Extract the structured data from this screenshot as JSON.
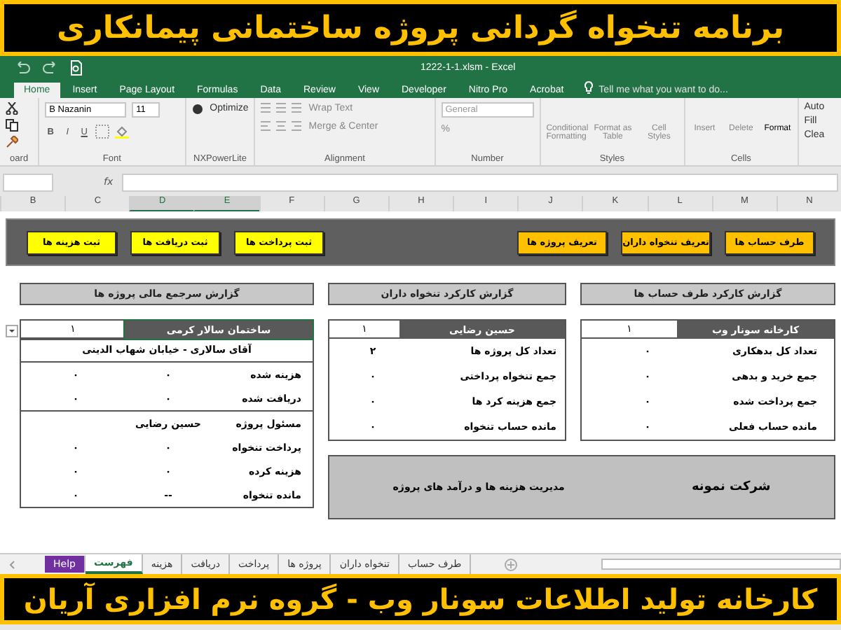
{
  "banner_top": {
    "title": "برنامه تنخواه گردانی پروژه ساختمانی پیمانکاری"
  },
  "window": {
    "title": "1222-1-1.xlsm - Excel",
    "tell_me": "Tell me what you want to do...",
    "tabs": [
      {
        "label": "Acrobat",
        "selected": false
      },
      {
        "label": "Nitro Pro",
        "selected": false
      },
      {
        "label": "Developer",
        "selected": false
      },
      {
        "label": "View",
        "selected": false
      },
      {
        "label": "Review",
        "selected": false
      },
      {
        "label": "Data",
        "selected": false
      },
      {
        "label": "Formulas",
        "selected": false
      },
      {
        "label": "Page Layout",
        "selected": false
      },
      {
        "label": "Insert",
        "selected": false
      },
      {
        "label": "Home",
        "selected": true
      }
    ]
  },
  "ribbon": {
    "clipboard_label": "oard",
    "font": {
      "name": "B Nazanin",
      "size": "11",
      "bold": "B",
      "italic": "I",
      "underline": "U",
      "label": "Font"
    },
    "nx": {
      "button": "Optimize",
      "label": "NXPowerLite"
    },
    "alignment": {
      "wrap": "Wrap Text",
      "merge": "Merge & Center",
      "label": "Alignment"
    },
    "number": {
      "format": "General",
      "percent": "%",
      "label": "Number"
    },
    "styles": {
      "buttons": [
        "Cell Styles",
        "Format as Table",
        "Conditional Formatting"
      ],
      "label": "Styles"
    },
    "cells": {
      "buttons": [
        "Format",
        "Delete",
        "Insert"
      ],
      "label": "Cells"
    },
    "editing": [
      "Auto",
      "Fill",
      "Clea"
    ]
  },
  "formula_bar": {
    "fx": "fx"
  },
  "columns": [
    {
      "label": "N",
      "selected": false
    },
    {
      "label": "M",
      "selected": false
    },
    {
      "label": "L",
      "selected": false
    },
    {
      "label": "K",
      "selected": false
    },
    {
      "label": "J",
      "selected": false
    },
    {
      "label": "I",
      "selected": false
    },
    {
      "label": "H",
      "selected": false
    },
    {
      "label": "G",
      "selected": false
    },
    {
      "label": "F",
      "selected": false
    },
    {
      "label": "E",
      "selected": true
    },
    {
      "label": "D",
      "selected": true
    },
    {
      "label": "C",
      "selected": false
    },
    {
      "label": "B",
      "selected": false
    }
  ],
  "buttons_right": [
    {
      "label": "طرف حساب ها",
      "color": "#ffc000"
    },
    {
      "label": "تعریف  تنخواه داران",
      "color": "#ffc000"
    },
    {
      "label": "تعریف پروژه ها",
      "color": "#ffc000"
    }
  ],
  "buttons_left": [
    {
      "label": "ثبت پرداخت ها",
      "color": "#ffff00"
    },
    {
      "label": "ثبت دریافت ها",
      "color": "#ffff00"
    },
    {
      "label": "ثبت هزینه ها",
      "color": "#ffff00"
    }
  ],
  "reports": [
    {
      "title": "گزارش کارکرد طرف حساب ها",
      "name": "کارخانه سونار وب",
      "number": "۱",
      "rows": [
        [
          "تعداد کل بدهکاری",
          "۰"
        ],
        [
          "جمع خرید و بدهی",
          "۰"
        ],
        [
          "جمع پرداخت شده",
          "۰"
        ],
        [
          "مانده حساب فعلی",
          "۰"
        ]
      ]
    },
    {
      "title": "گزارش کارکرد تنخواه داران",
      "name": "حسین رضایی",
      "number": "۱",
      "rows": [
        [
          "تعداد کل پروژه ها",
          "۲"
        ],
        [
          "جمع تنخواه پرداختی",
          "۰"
        ],
        [
          "جمع هزینه کرد ها",
          "۰"
        ],
        [
          "مانده حساب تنخواه",
          "۰"
        ]
      ]
    }
  ],
  "project_report": {
    "title": "گزارش سرجمع مالی پروژه ها",
    "name": "ساختمان سالار کرمی",
    "number": "۱",
    "subtitle": "آقای سالاری - خیابان شهاب الدینی",
    "rows": [
      [
        "هزینه شده",
        "۰",
        "۰"
      ],
      [
        "دریافت شده",
        "۰",
        "۰"
      ]
    ],
    "manager": [
      "مسئول پروژه",
      "حسین رضایی"
    ],
    "rows2": [
      [
        "پرداخت تنخواه",
        "۰",
        "۰"
      ],
      [
        "هزینه کرده",
        "۰",
        "۰"
      ],
      [
        "مانده تنخواه",
        "--",
        "۰"
      ]
    ]
  },
  "company": {
    "name": "شرکت نمونه",
    "subtitle": "مدیریت هزینه ها و درآمد های پروژه"
  },
  "sheet_tabs": [
    {
      "label": "طرف حساب",
      "kind": "sheet",
      "selected": false
    },
    {
      "label": "تنخواه داران",
      "kind": "sheet",
      "selected": false
    },
    {
      "label": "پروژه ها",
      "kind": "sheet",
      "selected": false
    },
    {
      "label": "پرداخت",
      "kind": "sheet",
      "selected": false
    },
    {
      "label": "دریافت",
      "kind": "sheet",
      "selected": false
    },
    {
      "label": "هزینه",
      "kind": "sheet",
      "selected": false
    },
    {
      "label": "فهرست",
      "kind": "sheet",
      "selected": true
    },
    {
      "label": "Help",
      "kind": "help",
      "selected": false
    }
  ],
  "banner_bottom": {
    "title": "کارخانه تولید اطلاعات سونار وب - گروه نرم افزاری آریان"
  }
}
